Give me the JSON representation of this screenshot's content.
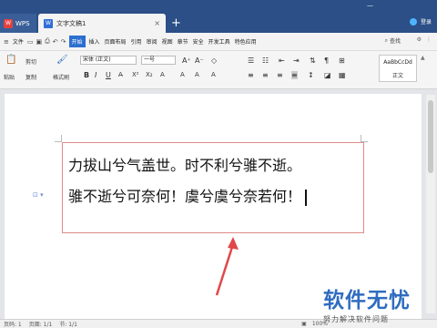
{
  "title_bar": {
    "wps_tab": "WPS",
    "doc_tab": "文字文稿1",
    "new_tab_symbol": "+",
    "user_label": "登录"
  },
  "menu": {
    "file_label": "文件",
    "items": [
      "开始",
      "插入",
      "页面布局",
      "引用",
      "审阅",
      "视图",
      "章节",
      "安全",
      "开发工具",
      "特色应用"
    ],
    "active_index": 0,
    "search_label": "查找"
  },
  "toolbar": {
    "paste_label": "粘贴",
    "cut_label": "剪切",
    "copy_label": "复制",
    "format_painter_label": "格式刷",
    "font_name": "宋体 (正文)",
    "font_size": "一号",
    "bold": "B",
    "italic": "I",
    "underline": "U",
    "style_preview": "AaBbCcDd",
    "style_name": "正文"
  },
  "document": {
    "lines": [
      "力拔山兮气盖世。时不利兮骓不逝。",
      "骓不逝兮可奈何！虞兮虞兮奈若何！"
    ]
  },
  "status_bar": {
    "page": "页码: 1",
    "pages": "页面: 1/1",
    "section": "节: 1/1",
    "zoom": "100%"
  },
  "watermark": {
    "logo": "软件无忧",
    "subtitle": "努力解决软件问题"
  },
  "colors": {
    "title_bar": "#2b4f86",
    "menu_active": "#2b6fd0",
    "textbox_border": "#e08a8a",
    "arrow": "#e0484a"
  }
}
